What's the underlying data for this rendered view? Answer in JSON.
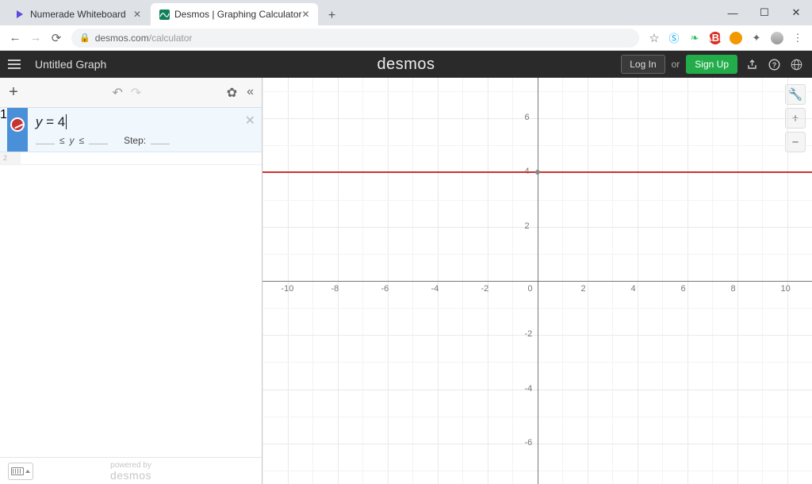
{
  "browser": {
    "tabs": [
      {
        "title": "Numerade Whiteboard",
        "active": false
      },
      {
        "title": "Desmos | Graphing Calculator",
        "active": true
      }
    ],
    "url_host": "desmos.com",
    "url_path": "/calculator"
  },
  "header": {
    "graph_title": "Untitled Graph",
    "logo": "desmos",
    "login": "Log In",
    "or": "or",
    "signup": "Sign Up"
  },
  "expression": {
    "index": "1",
    "formula_lhs": "y",
    "formula_eq": " = ",
    "formula_rhs": "4",
    "range_var": "y",
    "range_le": "≤",
    "step_label": "Step:",
    "color": "#c8342f"
  },
  "empty_row_index": "2",
  "footer": {
    "powered_top": "powered by",
    "powered_bottom": "desmos"
  },
  "graph": {
    "origin_label": "0",
    "x_ticks": [
      -10,
      -8,
      -6,
      -4,
      -2,
      2,
      4,
      6,
      8,
      10
    ],
    "y_ticks": [
      6,
      4,
      2,
      -2,
      -4,
      -6
    ],
    "x_range": [
      -11,
      11
    ],
    "y_range": [
      -7.5,
      7.5
    ]
  },
  "chart_data": {
    "type": "line",
    "title": "",
    "xlabel": "",
    "ylabel": "",
    "xlim": [
      -11,
      11
    ],
    "ylim": [
      -7.5,
      7.5
    ],
    "series": [
      {
        "name": "y = 4",
        "color": "#c8342f",
        "equation": "y = 4",
        "y_value": 4
      }
    ],
    "gridlines": {
      "x_major_step": 2,
      "y_major_step": 2,
      "x_minor_step": 1,
      "y_minor_step": 1
    }
  }
}
